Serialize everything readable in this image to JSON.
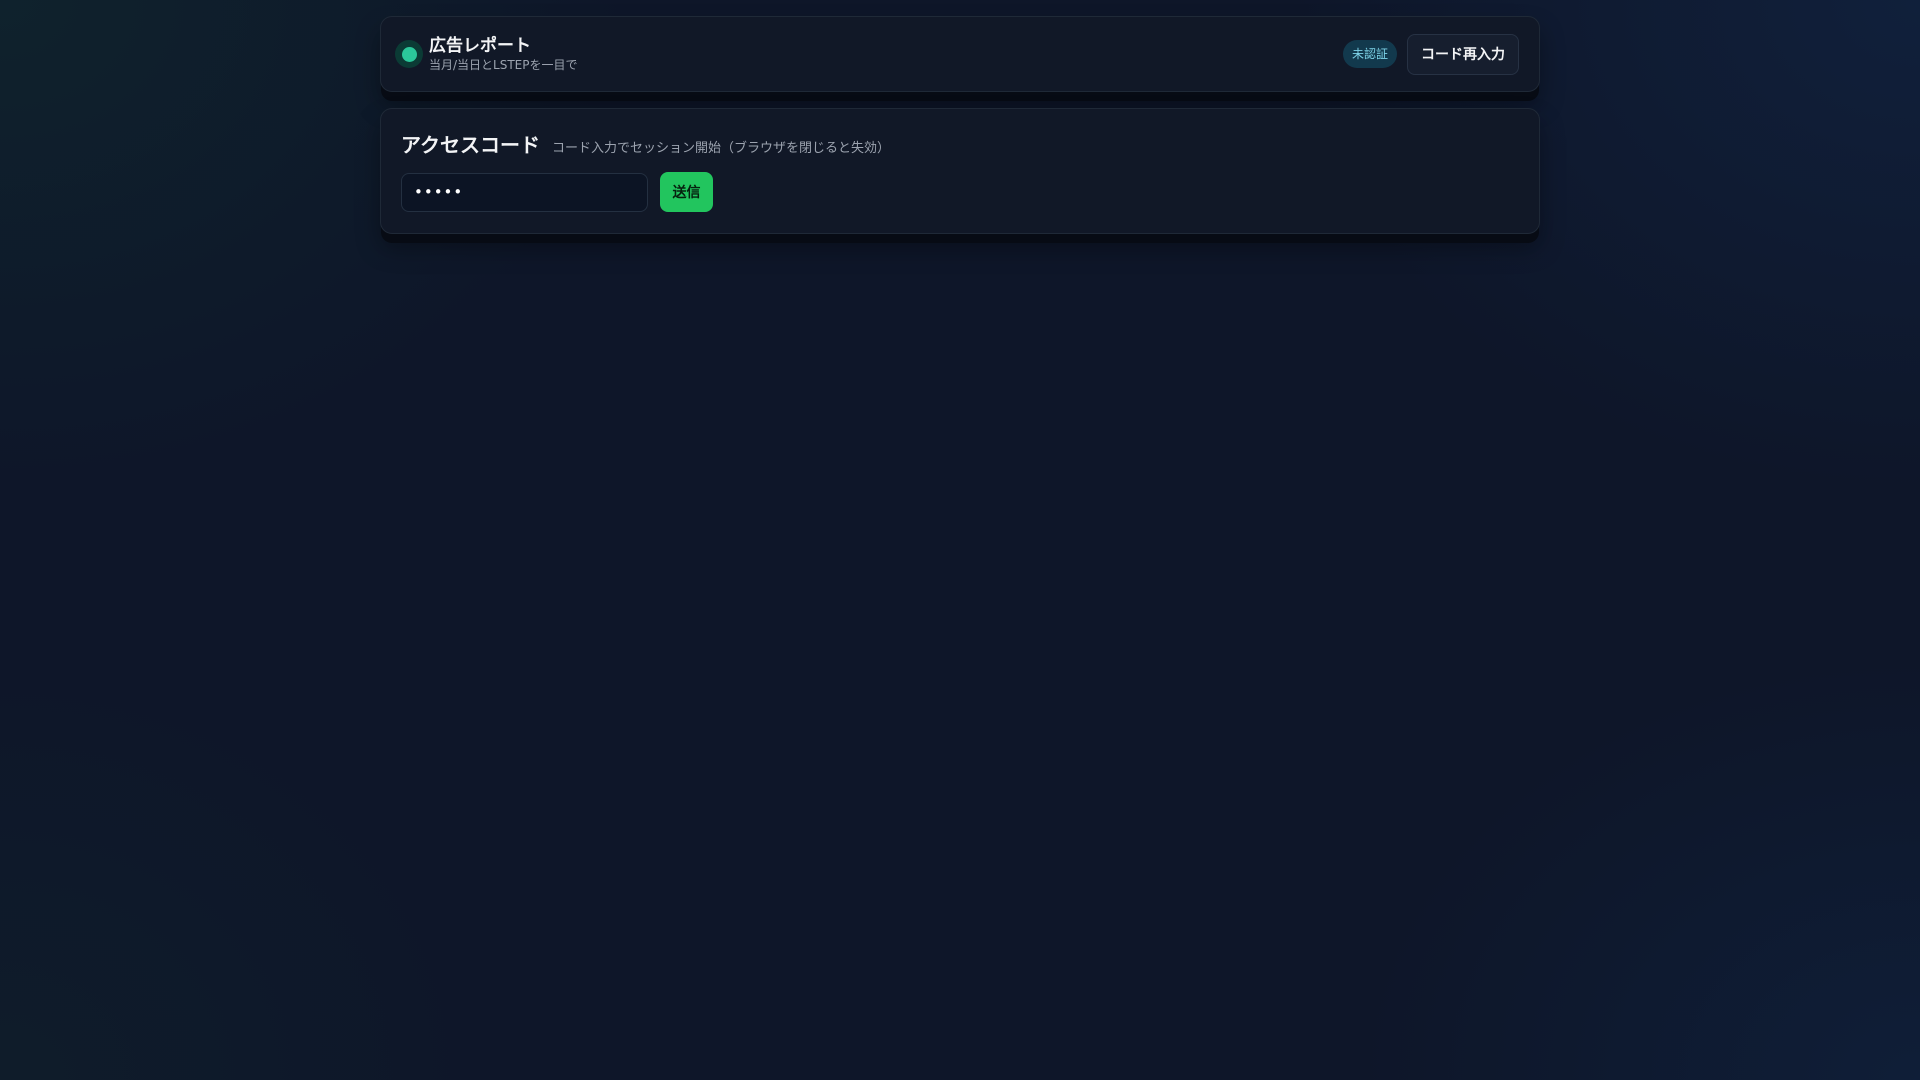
{
  "header": {
    "title": "広告レポート",
    "subtitle": "当月/当日とLSTEPを一目で",
    "status_badge": "未認証",
    "reenter_button_label": "コード再入力"
  },
  "access": {
    "title": "アクセスコード",
    "hint": "コード入力でセッション開始（ブラウザを閉じると失効）",
    "code_input_value": "•••••",
    "submit_label": "送信"
  },
  "colors": {
    "accent_green": "#22c55e",
    "brand_dot": "#2bc79a",
    "badge_bg": "#12394d",
    "badge_text": "#7dd3e8",
    "card_bg": "#111827",
    "page_bg": "#0e1629"
  },
  "icons": {
    "brand": "status-dot-icon"
  }
}
